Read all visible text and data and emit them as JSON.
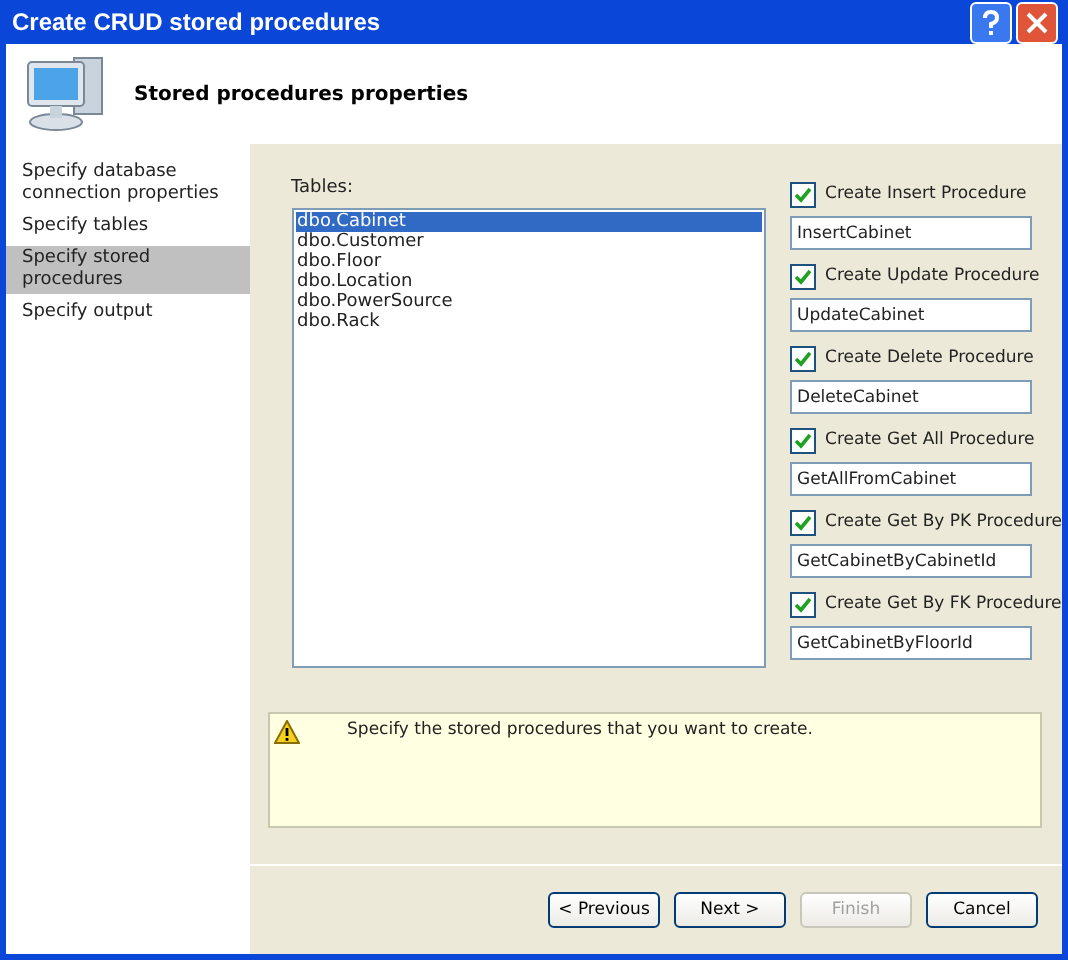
{
  "window": {
    "title": "Create CRUD stored procedures"
  },
  "header": {
    "title": "Stored procedures properties"
  },
  "sidebar": {
    "items": [
      {
        "label": "Specify database connection properties",
        "selected": false
      },
      {
        "label": "Specify tables",
        "selected": false
      },
      {
        "label": "Specify stored procedures",
        "selected": true
      },
      {
        "label": "Specify output",
        "selected": false
      }
    ]
  },
  "tables": {
    "label": "Tables:",
    "items": [
      {
        "label": "dbo.Cabinet",
        "selected": true
      },
      {
        "label": "dbo.Customer",
        "selected": false
      },
      {
        "label": "dbo.Floor",
        "selected": false
      },
      {
        "label": "dbo.Location",
        "selected": false
      },
      {
        "label": "dbo.PowerSource",
        "selected": false
      },
      {
        "label": "dbo.Rack",
        "selected": false
      }
    ]
  },
  "procedures": [
    {
      "label": "Create Insert Procedure",
      "checked": true,
      "value": "InsertCabinet"
    },
    {
      "label": "Create Update Procedure",
      "checked": true,
      "value": "UpdateCabinet"
    },
    {
      "label": "Create Delete Procedure",
      "checked": true,
      "value": "DeleteCabinet"
    },
    {
      "label": "Create Get All Procedure",
      "checked": true,
      "value": "GetAllFromCabinet"
    },
    {
      "label": "Create Get By PK Procedure",
      "checked": true,
      "value": "GetCabinetByCabinetId"
    },
    {
      "label": "Create Get By FK Procedure",
      "checked": true,
      "value": "GetCabinetByFloorId"
    }
  ],
  "message": {
    "text": "Specify the stored procedures that you want to create."
  },
  "buttons": [
    {
      "label": "< Previous",
      "disabled": false
    },
    {
      "label": "Next >",
      "disabled": false
    },
    {
      "label": "Finish",
      "disabled": true
    },
    {
      "label": "Cancel",
      "disabled": false
    }
  ]
}
